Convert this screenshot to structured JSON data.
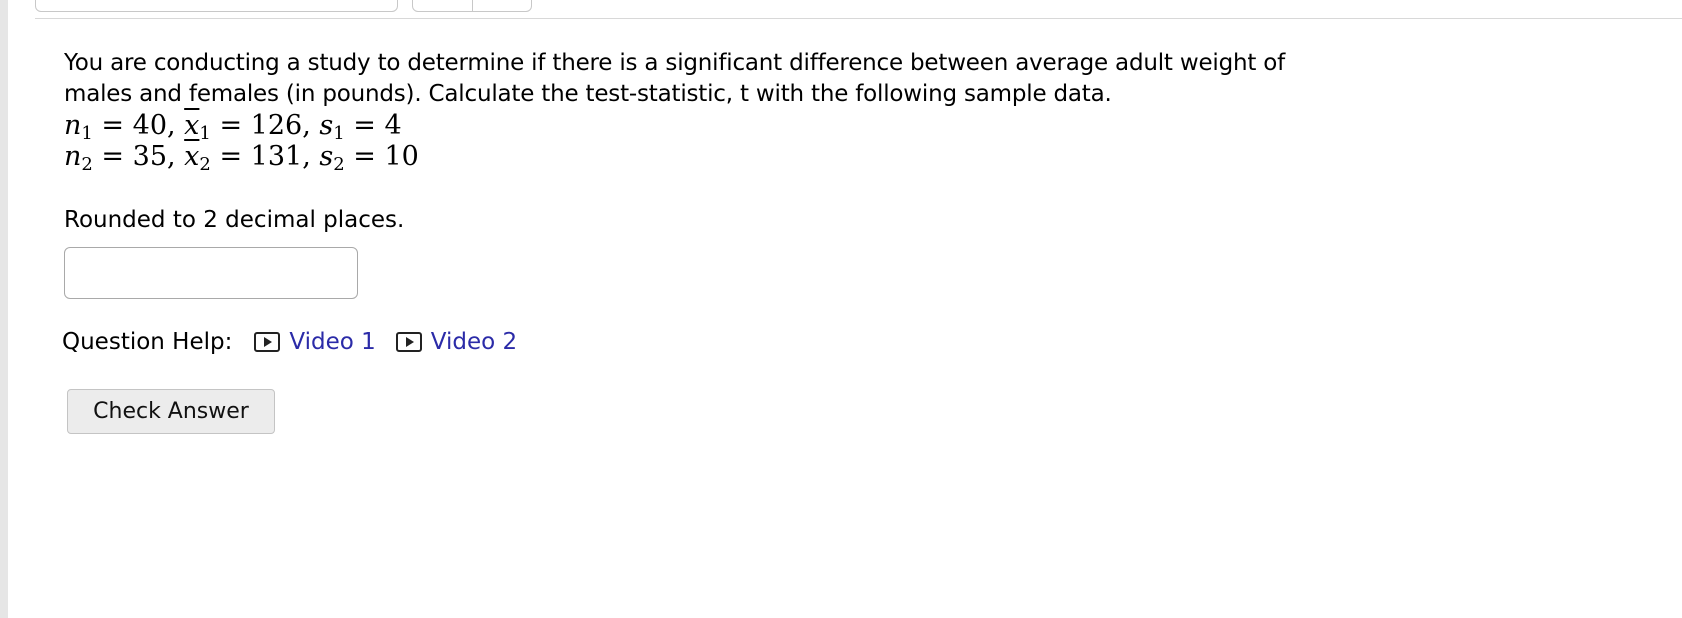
{
  "question": {
    "text": "You are conducting a study to determine if there is a significant difference between average adult weight of males and females (in pounds). Calculate the test-statistic, t with the following sample data.",
    "sample1": {
      "n": "40",
      "xbar": "126",
      "s": "4"
    },
    "sample2": {
      "n": "35",
      "xbar": "131",
      "s": "10"
    },
    "rounding_note": "Rounded to 2 decimal places.",
    "answer_value": "",
    "answer_placeholder": ""
  },
  "help": {
    "label": "Question Help:",
    "videos": [
      {
        "label": "Video 1",
        "icon": "play-icon"
      },
      {
        "label": "Video 2",
        "icon": "play-icon"
      }
    ]
  },
  "actions": {
    "check_label": "Check Answer"
  },
  "colors": {
    "link": "#2b2ba8",
    "button_bg": "#ececec",
    "rule": "#d8d8d8"
  }
}
